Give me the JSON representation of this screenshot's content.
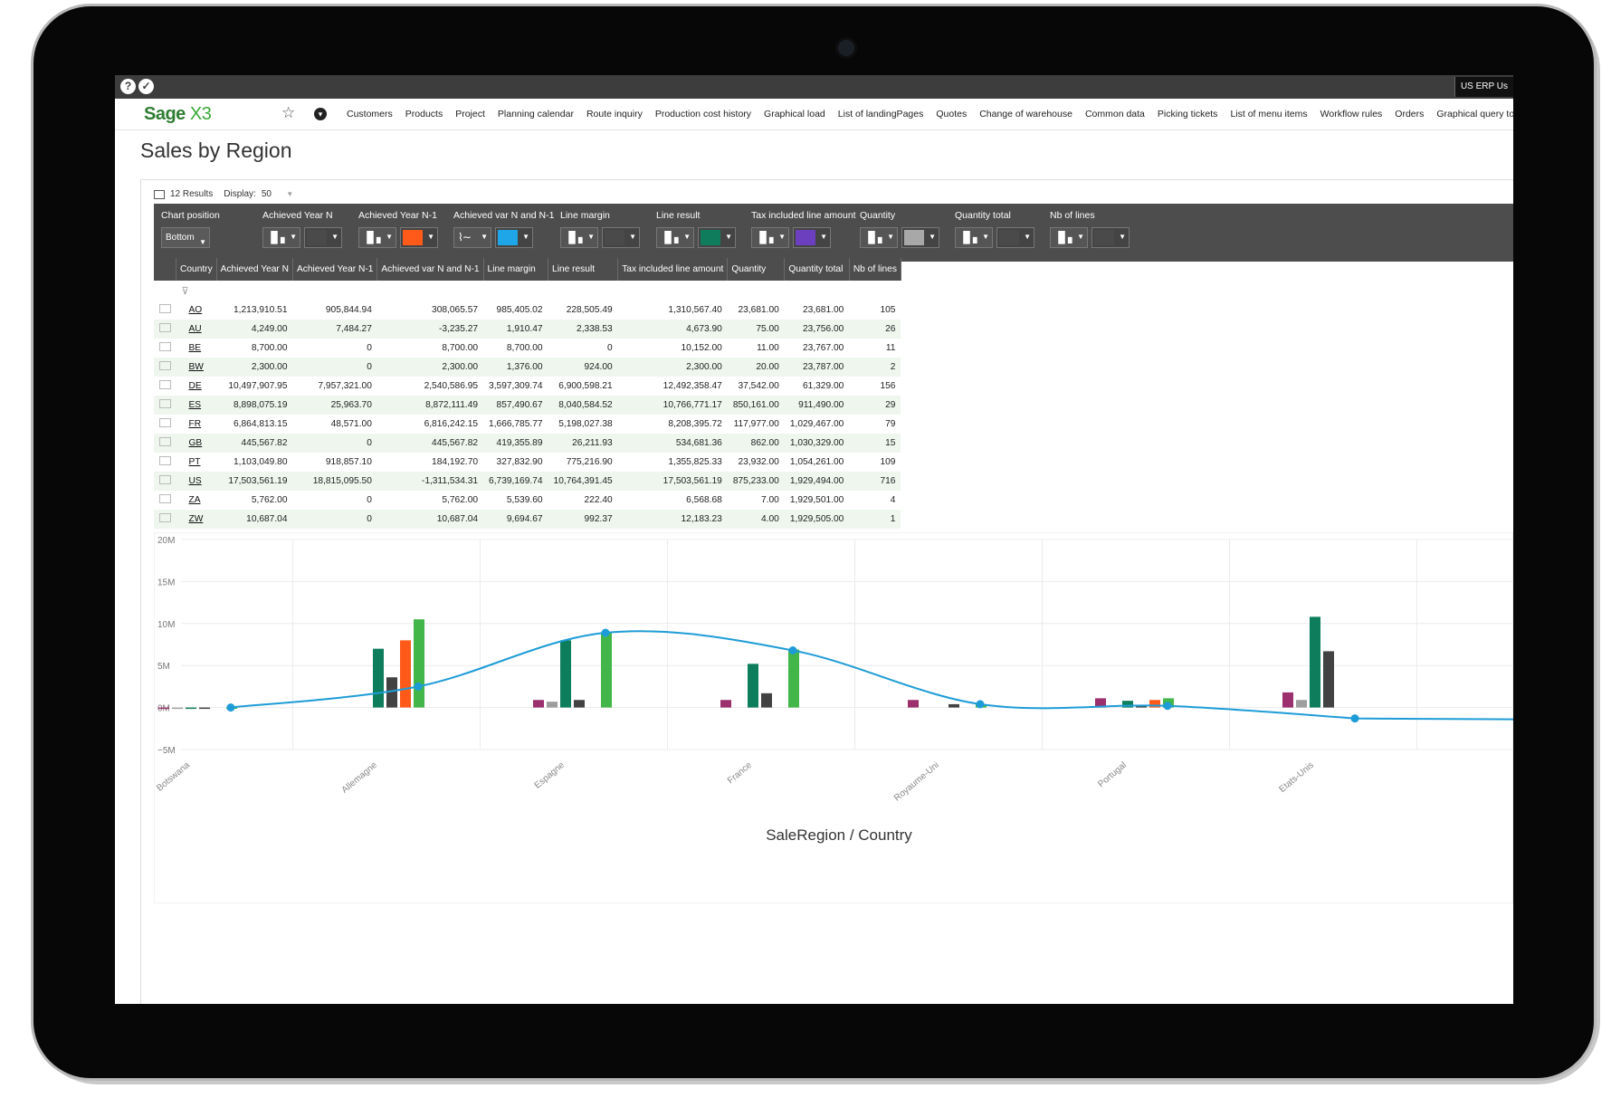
{
  "app": {
    "help_icon": "?",
    "tools_icon": "✓",
    "user": "US ERP Us",
    "logo_main": "Sage",
    "logo_sub": "X3"
  },
  "menu": [
    "Customers",
    "Products",
    "Project",
    "Planning calendar",
    "Route inquiry",
    "Production cost history",
    "Graphical load",
    "List of landingPages",
    "Quotes",
    "Change of warehouse",
    "Common data",
    "Picking tickets",
    "List of menu items",
    "Workflow rules",
    "Orders",
    "Graphical query tool"
  ],
  "page": {
    "title": "Sales by Region"
  },
  "results": {
    "count_label": "12 Results",
    "display_label": "Display:",
    "display_value": "50"
  },
  "toolbar": {
    "chart_position_label": "Chart position",
    "chart_position_value": "Bottom",
    "measures": [
      {
        "label": "Achieved Year N",
        "color": "",
        "kind": "bar"
      },
      {
        "label": "Achieved Year N-1",
        "color": "#ff5a1a",
        "kind": "bar"
      },
      {
        "label": "Achieved var N and N-1",
        "color": "#1ea6e8",
        "kind": "line"
      },
      {
        "label": "Line margin",
        "color": "",
        "kind": "bar"
      },
      {
        "label": "Line result",
        "color": "#0f7d5c",
        "kind": "bar"
      },
      {
        "label": "Tax included line amount",
        "color": "#6b3fbd",
        "kind": "bar"
      },
      {
        "label": "Quantity",
        "color": "#a8a8a8",
        "kind": "bar"
      },
      {
        "label": "Quantity total",
        "color": "",
        "kind": "bar"
      },
      {
        "label": "Nb of lines",
        "color": "",
        "kind": "bar"
      }
    ]
  },
  "table": {
    "columns": [
      "Country",
      "Achieved Year N",
      "Achieved Year N-1",
      "Achieved var N and N-1",
      "Line margin",
      "Line result",
      "Tax included line amount",
      "Quantity",
      "Quantity total",
      "Nb of lines"
    ],
    "rows": [
      [
        "AO",
        "1,213,910.51",
        "905,844.94",
        "308,065.57",
        "985,405.02",
        "228,505.49",
        "1,310,567.40",
        "23,681.00",
        "23,681.00",
        "105"
      ],
      [
        "AU",
        "4,249.00",
        "7,484.27",
        "-3,235.27",
        "1,910.47",
        "2,338.53",
        "4,673.90",
        "75.00",
        "23,756.00",
        "26"
      ],
      [
        "BE",
        "8,700.00",
        "0",
        "8,700.00",
        "8,700.00",
        "0",
        "10,152.00",
        "11.00",
        "23,767.00",
        "11"
      ],
      [
        "BW",
        "2,300.00",
        "0",
        "2,300.00",
        "1,376.00",
        "924.00",
        "2,300.00",
        "20.00",
        "23,787.00",
        "2"
      ],
      [
        "DE",
        "10,497,907.95",
        "7,957,321.00",
        "2,540,586.95",
        "3,597,309.74",
        "6,900,598.21",
        "12,492,358.47",
        "37,542.00",
        "61,329.00",
        "156"
      ],
      [
        "ES",
        "8,898,075.19",
        "25,963.70",
        "8,872,111.49",
        "857,490.67",
        "8,040,584.52",
        "10,766,771.17",
        "850,161.00",
        "911,490.00",
        "29"
      ],
      [
        "FR",
        "6,864,813.15",
        "48,571.00",
        "6,816,242.15",
        "1,666,785.77",
        "5,198,027.38",
        "8,208,395.72",
        "117,977.00",
        "1,029,467.00",
        "79"
      ],
      [
        "GB",
        "445,567.82",
        "0",
        "445,567.82",
        "419,355.89",
        "26,211.93",
        "534,681.36",
        "862.00",
        "1,030,329.00",
        "15"
      ],
      [
        "PT",
        "1,103,049.80",
        "918,857.10",
        "184,192.70",
        "327,832.90",
        "775,216.90",
        "1,355,825.33",
        "23,932.00",
        "1,054,261.00",
        "109"
      ],
      [
        "US",
        "17,503,561.19",
        "18,815,095.50",
        "-1,311,534.31",
        "6,739,169.74",
        "10,764,391.45",
        "17,503,561.19",
        "875,233.00",
        "1,929,494.00",
        "716"
      ],
      [
        "ZA",
        "5,762.00",
        "0",
        "5,762.00",
        "5,539.60",
        "222.40",
        "6,568.68",
        "7.00",
        "1,929,501.00",
        "4"
      ],
      [
        "ZW",
        "10,687.04",
        "0",
        "10,687.04",
        "9,694.67",
        "992.37",
        "12,183.23",
        "4.00",
        "1,929,505.00",
        "1"
      ]
    ]
  },
  "chart_data": {
    "type": "bar",
    "xlabel": "SaleRegion / Country",
    "ylabel": "",
    "ylim": [
      -5,
      20
    ],
    "y_ticks": [
      "20M",
      "15M",
      "10M",
      "5M",
      "0M",
      "−5M"
    ],
    "categories": [
      "Botswana",
      "Allemagne",
      "Espagne",
      "France",
      "Royaume-Uni",
      "Portugal",
      "Etats-Unis"
    ],
    "bar_series": [
      {
        "name": "Tax included line amount",
        "color": "#9c2f6e",
        "values": [
          0.0023,
          0,
          0.9,
          0.9,
          0.9,
          1.1,
          1.8
        ]
      },
      {
        "name": "Quantity",
        "color": "#9e9e9e",
        "values": [
          0.0002,
          0,
          0.7,
          0,
          0,
          0,
          0.9
        ]
      },
      {
        "name": "Line result",
        "color": "#0d7d5b",
        "values": [
          0.0009,
          7.0,
          8.0,
          5.2,
          0,
          0.8,
          10.8
        ]
      },
      {
        "name": "Line margin",
        "color": "#424242",
        "values": [
          0.0014,
          3.6,
          0.9,
          1.7,
          0.4,
          0.3,
          6.7
        ]
      },
      {
        "name": "Achieved Year N-1",
        "color": "#ff5a1a",
        "values": [
          0,
          8.0,
          0,
          0,
          0,
          0.9,
          0
        ]
      },
      {
        "name": "Achieved Year N",
        "color": "#43b649",
        "values": [
          0.0023,
          10.5,
          8.9,
          6.9,
          0.4,
          1.1,
          0
        ]
      }
    ],
    "line_series": {
      "name": "Achieved var N and N-1",
      "color": "#1e9cd7",
      "values": [
        0.0023,
        2.5,
        8.9,
        6.8,
        0.4,
        0.2,
        -1.3
      ]
    }
  }
}
